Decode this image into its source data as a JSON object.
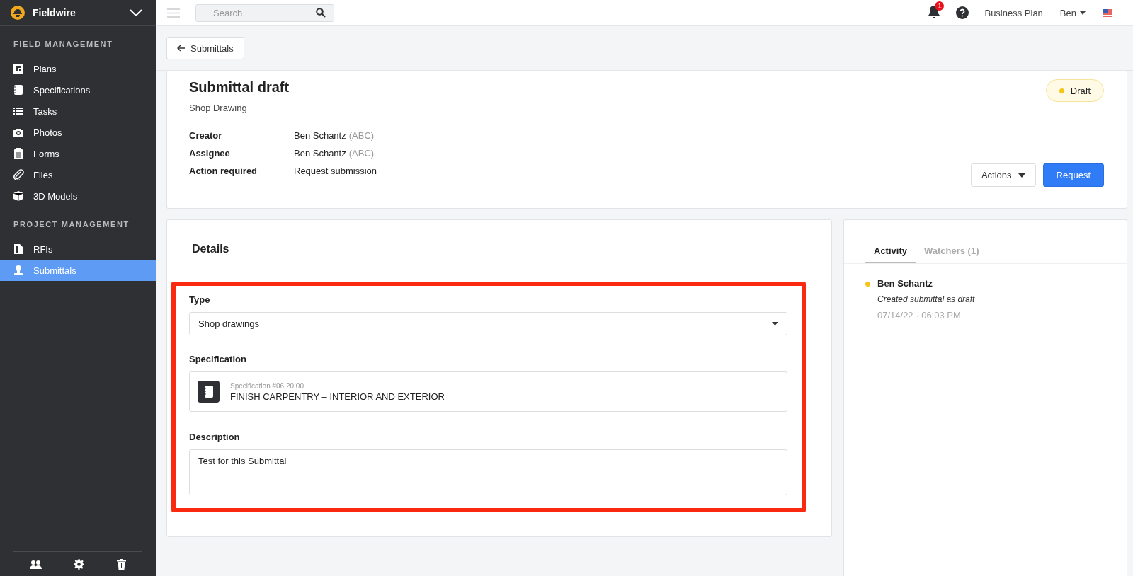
{
  "sidebar": {
    "brand": "Fieldwire",
    "sections": [
      {
        "title": "FIELD MANAGEMENT",
        "items": [
          {
            "label": "Plans",
            "selected": false
          },
          {
            "label": "Specifications",
            "selected": false
          },
          {
            "label": "Tasks",
            "selected": false
          },
          {
            "label": "Photos",
            "selected": false
          },
          {
            "label": "Forms",
            "selected": false
          },
          {
            "label": "Files",
            "selected": false
          },
          {
            "label": "3D Models",
            "selected": false
          }
        ]
      },
      {
        "title": "PROJECT MANAGEMENT",
        "items": [
          {
            "label": "RFIs",
            "selected": false
          },
          {
            "label": "Submittals",
            "selected": true
          }
        ]
      }
    ]
  },
  "topbar": {
    "search": {
      "placeholder": "Search"
    },
    "notification_count": "1",
    "plan": "Business Plan",
    "user": "Ben"
  },
  "back_button": "Submittals",
  "submittal": {
    "title": "Submittal draft",
    "subtitle": "Shop Drawing",
    "status": {
      "label": "Draft",
      "color": "#f5c518"
    },
    "fields": [
      {
        "label": "Creator",
        "value": "Ben Schantz",
        "note": "(ABC)"
      },
      {
        "label": "Assignee",
        "value": "Ben Schantz",
        "note": "(ABC)"
      },
      {
        "label": "Action required",
        "value": "Request submission"
      }
    ],
    "buttons": {
      "actions": "Actions",
      "request": "Request"
    }
  },
  "details": {
    "title": "Details",
    "type_label": "Type",
    "type_value": "Shop drawings",
    "specification_label": "Specification",
    "specification": {
      "number": "Specification #06 20 00",
      "name": "FINISH CARPENTRY – INTERIOR AND EXTERIOR"
    },
    "description_label": "Description",
    "description": "Test for this Submittal"
  },
  "activity": {
    "tabs": [
      {
        "label": "Activity",
        "selected": true
      },
      {
        "label": "Watchers (1)",
        "selected": false
      }
    ],
    "entries": [
      {
        "author": "Ben Schantz",
        "text": "Created submittal as draft",
        "time": "07/14/22 · 06:03 PM",
        "color": "#f5c518"
      }
    ]
  }
}
